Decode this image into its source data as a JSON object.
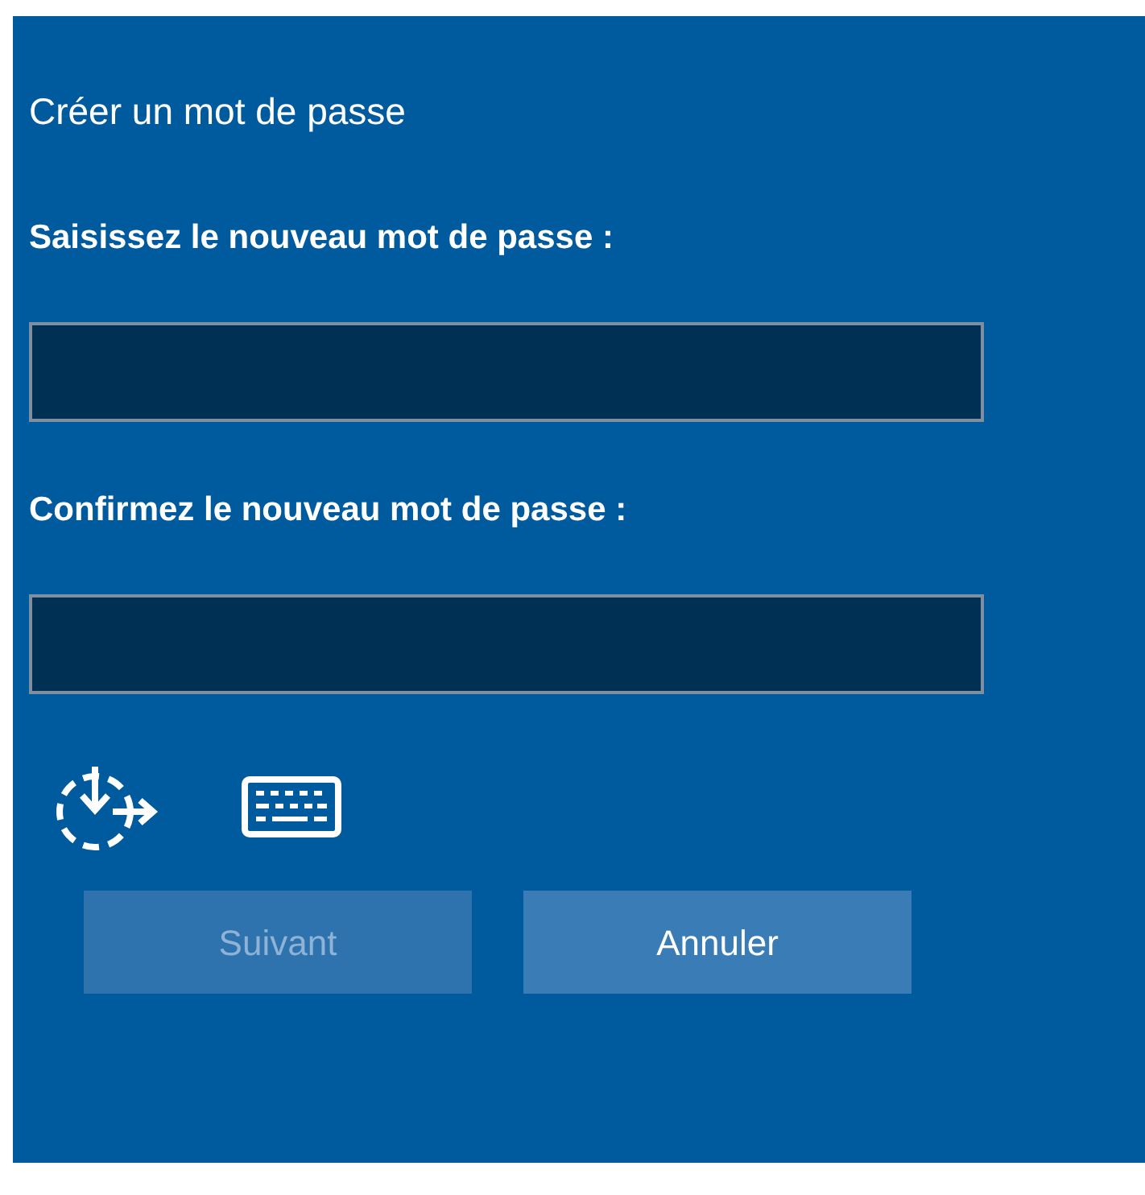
{
  "title": "Créer un mot de passe",
  "fields": [
    {
      "label": "Saisissez le nouveau mot de passe :"
    },
    {
      "label": "Confirmez le nouveau mot de passe :"
    }
  ],
  "buttons": [
    {
      "label": "Suivant",
      "disabled": true
    },
    {
      "label": "Annuler",
      "disabled": false
    }
  ]
}
